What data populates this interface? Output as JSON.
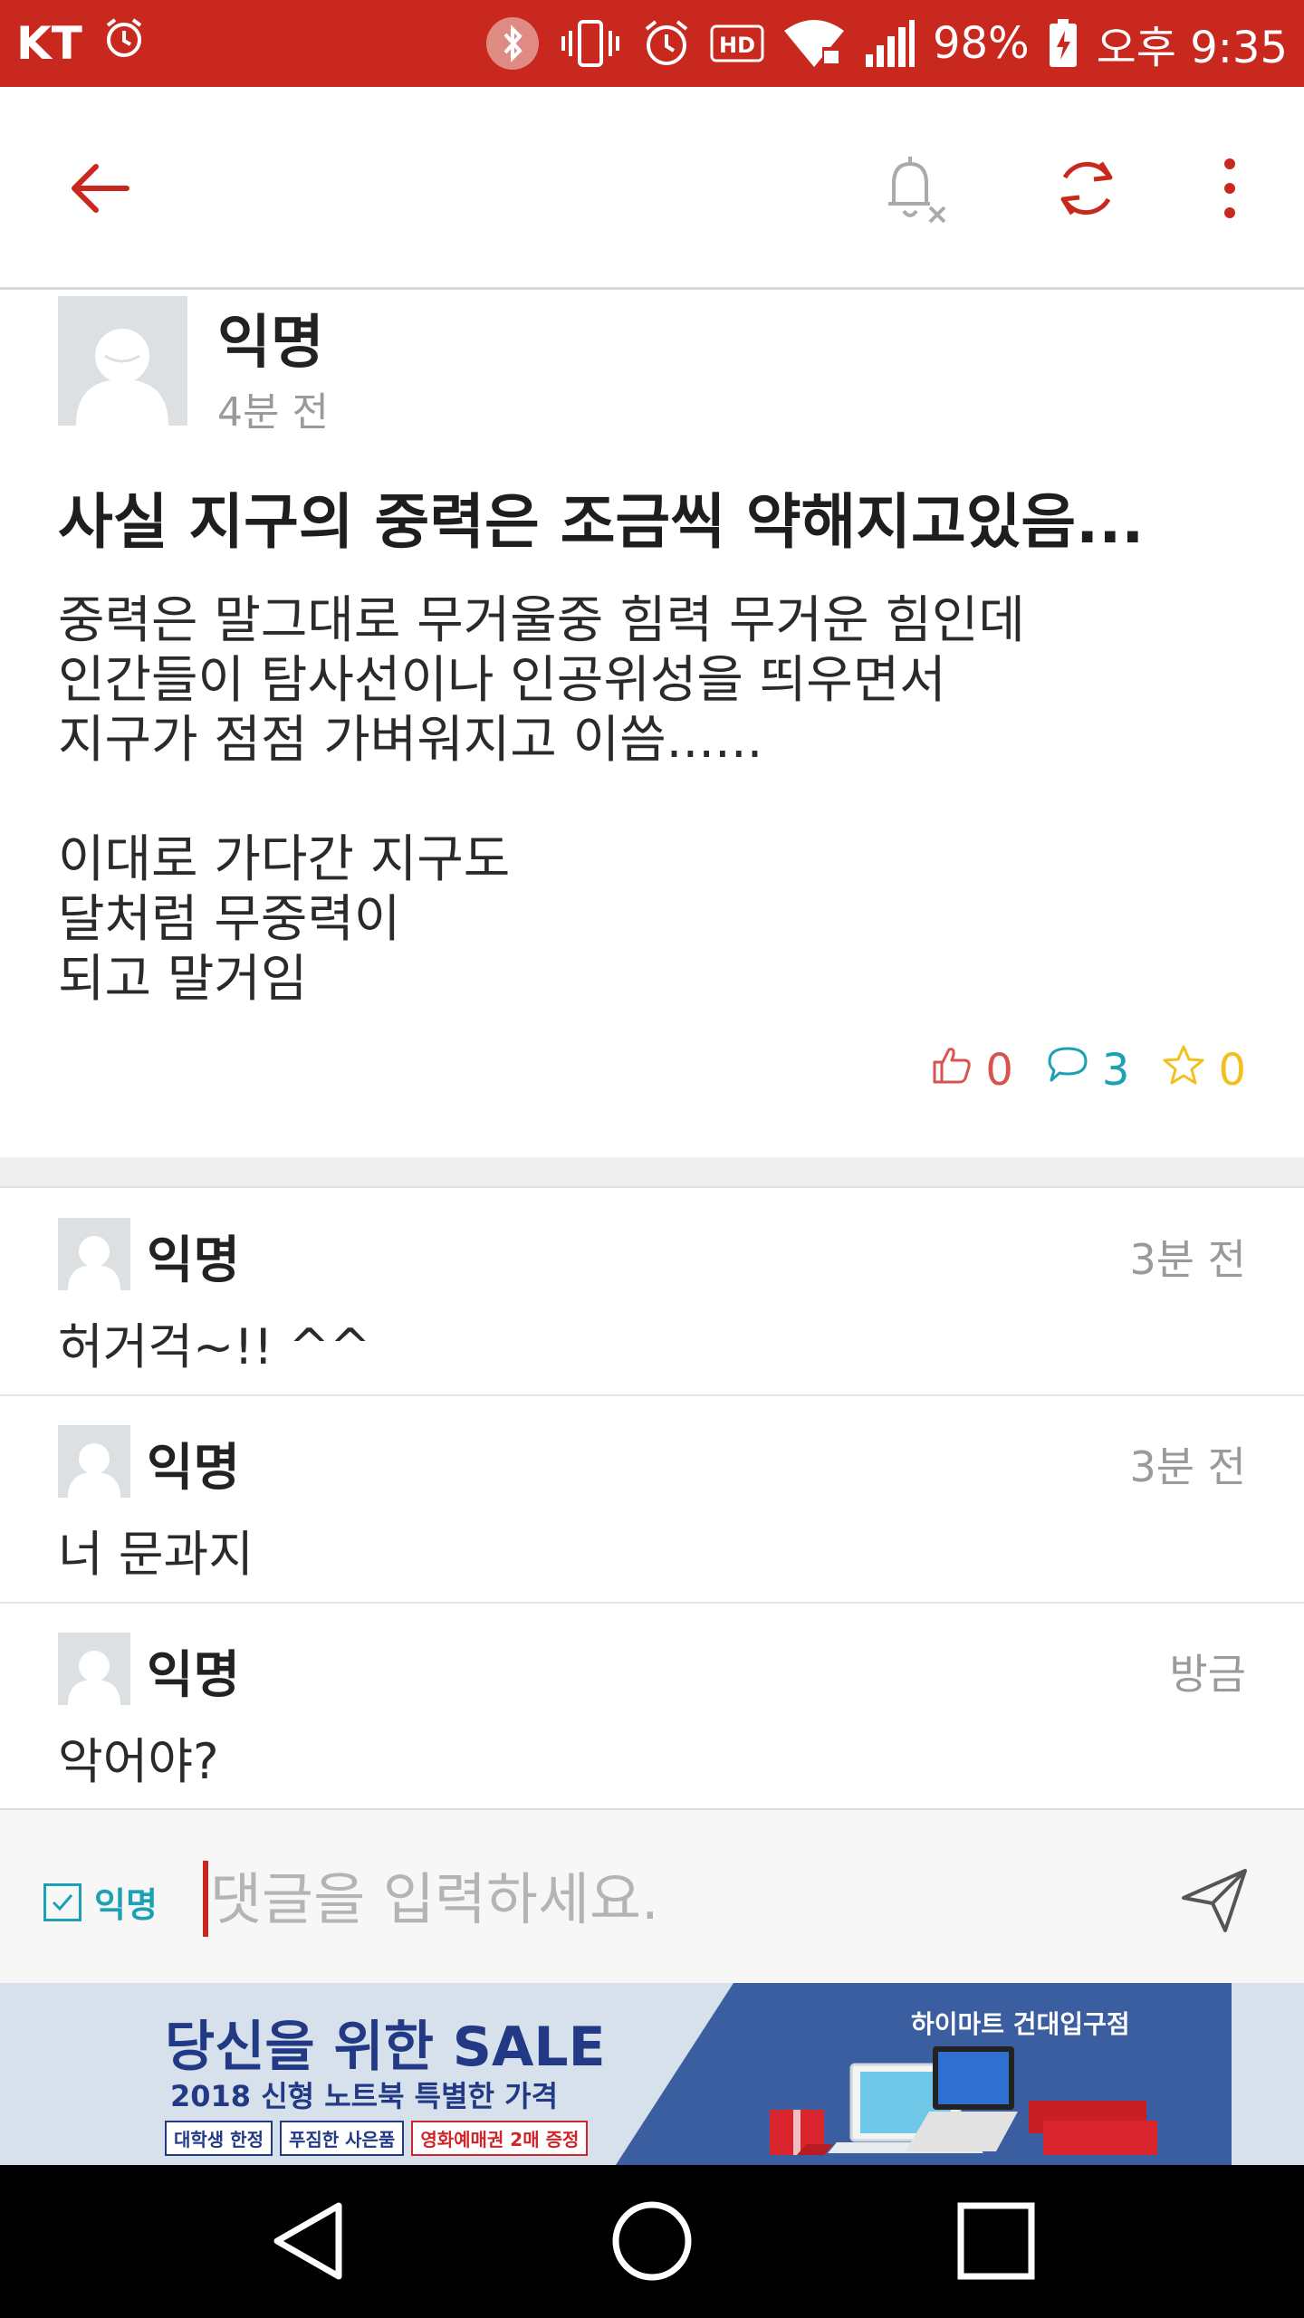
{
  "status_bar": {
    "carrier": "KT",
    "battery": "98%",
    "clock": "오후 9:35",
    "icons": [
      "alarm-icon",
      "bluetooth-icon",
      "vibrate-icon",
      "alarm-icon",
      "hd-icon",
      "wifi-icon",
      "signal-icon",
      "battery-icon"
    ]
  },
  "app_bar": {
    "icons": [
      "back-arrow-icon",
      "notification-off-icon",
      "refresh-icon",
      "more-vert-icon"
    ],
    "accent_color": "#c8281e"
  },
  "post": {
    "author": "익명",
    "time": "4분 전",
    "title": "사실 지구의 중력은 조금씩 약해지고있음...",
    "body": [
      "중력은 말그대로 무거울중 힘력 무거운 힘인데",
      "인간들이 탐사선이나 인공위성을 띄우면서",
      "지구가 점점 가벼워지고 이씀......",
      "",
      "이대로 가다간 지구도",
      "달처럼 무중력이",
      "되고 말거임"
    ],
    "likes": "0",
    "comments": "3",
    "scraps": "0",
    "like_color": "#d9534f",
    "comment_color": "#1ca0b3",
    "scrap_color": "#f2c01e"
  },
  "comments": [
    {
      "author": "익명",
      "time": "3분 전",
      "text": "허거걱~!! ^^"
    },
    {
      "author": "익명",
      "time": "3분 전",
      "text": "너 문과지"
    },
    {
      "author": "익명",
      "time": "방금",
      "text": "악어야?"
    }
  ],
  "input_bar": {
    "anonymous_label": "익명",
    "anonymous_checked": true,
    "placeholder": "댓글을 입력하세요."
  },
  "ad": {
    "headline": "당신을 위한 SALE",
    "subline": "2018 신형 노트북 특별한 가격",
    "tags": [
      "대학생 한정",
      "푸짐한 사은품",
      "영화예매권 2매 증정"
    ],
    "store": "하이마트 건대입구점"
  },
  "nav_bar": {
    "icons": [
      "back-triangle-icon",
      "home-circle-icon",
      "recents-square-icon"
    ]
  }
}
